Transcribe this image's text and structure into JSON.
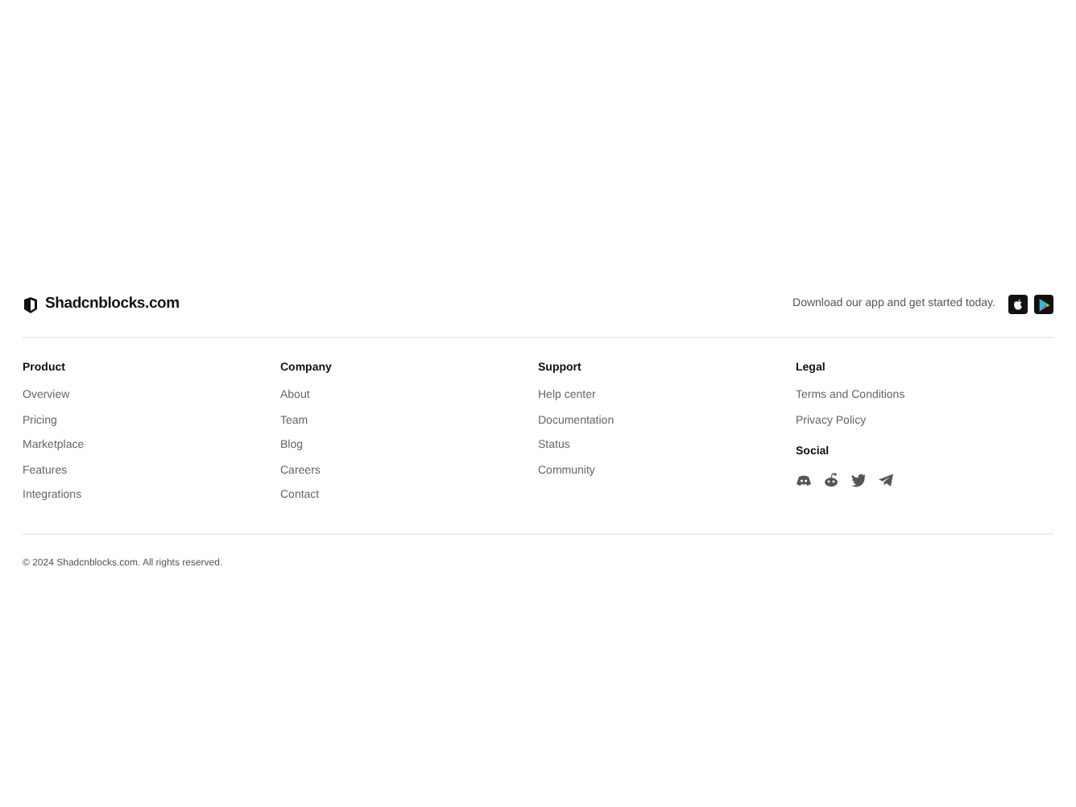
{
  "brand": {
    "name": "Shadcnblocks.com"
  },
  "app_download": {
    "text": "Download our app and get started today.",
    "stores": [
      {
        "kind": "apple"
      },
      {
        "kind": "play"
      }
    ]
  },
  "columns": [
    {
      "heading": "Product",
      "links": [
        "Overview",
        "Pricing",
        "Marketplace",
        "Features",
        "Integrations"
      ]
    },
    {
      "heading": "Company",
      "links": [
        "About",
        "Team",
        "Blog",
        "Careers",
        "Contact"
      ]
    },
    {
      "heading": "Support",
      "links": [
        "Help center",
        "Documentation",
        "Status",
        "Community"
      ]
    },
    {
      "heading": "Legal",
      "links": [
        "Terms and Conditions",
        "Privacy Policy"
      ],
      "social": {
        "heading": "Social",
        "icons": [
          {
            "kind": "discord"
          },
          {
            "kind": "reddit"
          },
          {
            "kind": "twitter"
          },
          {
            "kind": "telegram"
          }
        ]
      }
    }
  ],
  "copyright": "© 2024 Shadcnblocks.com. All rights reserved."
}
